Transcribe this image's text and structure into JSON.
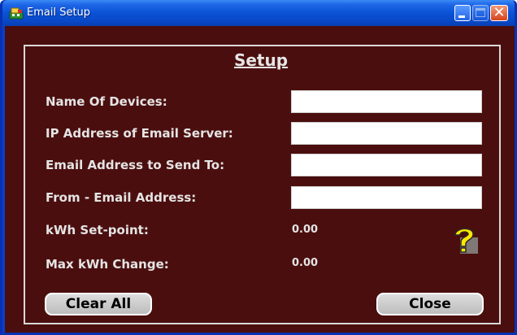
{
  "window": {
    "title": "Email Setup",
    "close_glyph": "✕"
  },
  "form": {
    "heading": "Setup",
    "fields": [
      {
        "label": "Name Of Devices:",
        "value": "",
        "placeholder": ""
      },
      {
        "label": "IP Address of Email Server:",
        "value": "",
        "placeholder": ""
      },
      {
        "label": "Email Address to Send To:",
        "value": "",
        "placeholder": ""
      },
      {
        "label": "From - Email Address:",
        "value": "",
        "placeholder": ""
      }
    ],
    "readouts": [
      {
        "label": "kWh Set-point:",
        "value": "0.00"
      },
      {
        "label": "Max kWh Change:",
        "value": "0.00"
      }
    ],
    "help_icon": "question-mark-icon"
  },
  "buttons": {
    "clear_all": "Clear All",
    "close": "Close"
  },
  "colors": {
    "background": "#4b0e0e",
    "title_bar": "#0a52d6",
    "text": "#e4e4e4",
    "frame_border": "#d9d9d9"
  }
}
